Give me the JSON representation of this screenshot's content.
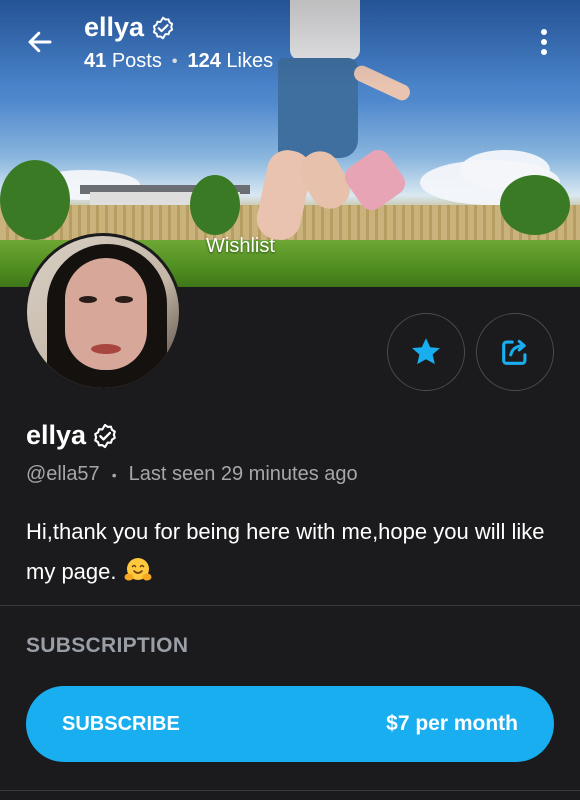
{
  "header": {
    "name": "ellya",
    "posts_count": "41",
    "posts_label": "Posts",
    "likes_count": "124",
    "likes_label": "Likes",
    "separator": "•"
  },
  "cover": {
    "wishlist_label": "Wishlist"
  },
  "profile": {
    "name": "ellya",
    "username": "@ella57",
    "separator": "•",
    "last_seen": "Last seen 29 minutes ago",
    "bio": "Hi,thank you for being here with me,hope you will like my page."
  },
  "subscription": {
    "section_title": "SUBSCRIPTION",
    "button_label": "SUBSCRIBE",
    "price": "$7 per month"
  },
  "colors": {
    "accent": "#19aef0",
    "background": "#1b1b1d",
    "muted_text": "#a6a6ab"
  },
  "icons": {
    "back": "arrow-left-icon",
    "verified": "verified-badge-icon",
    "more": "more-vertical-icon",
    "favorite": "star-icon",
    "share": "share-icon",
    "bio_emoji": "hugging-face-emoji"
  }
}
